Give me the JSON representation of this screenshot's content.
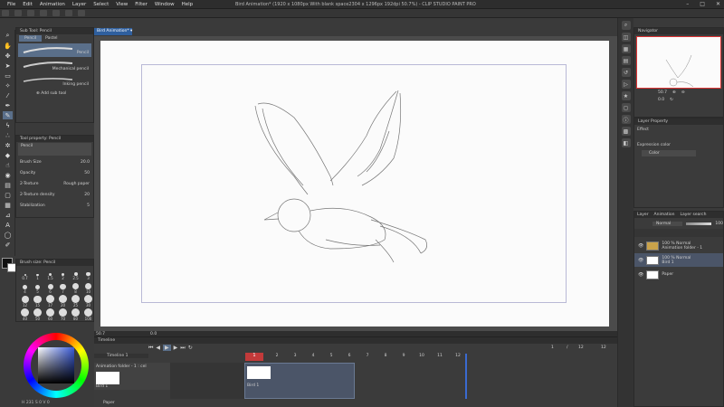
{
  "menu": [
    "File",
    "Edit",
    "Animation",
    "Layer",
    "Select",
    "View",
    "Filter",
    "Window",
    "Help"
  ],
  "window_title": "Bird Animation* (1920 x 1080px With blank space2304 x 1296px 192dpi 50.7%) - CLIP STUDIO PAINT PRO",
  "window_buttons": [
    "–",
    "□",
    "✕"
  ],
  "doc_tab": "Bird Animation* ▾",
  "subtool": {
    "header": "Sub Tool: Pencil",
    "tabs": [
      "Pencil",
      "Pastel"
    ],
    "items": [
      "Pencil",
      "Mechanical pencil",
      "Inking pencil"
    ],
    "add": "Add sub tool"
  },
  "tool_property": {
    "header": "Tool property: Pencil",
    "tool_name": "Pencil",
    "rows": [
      {
        "label": "Brush Size",
        "value": "20.0"
      },
      {
        "label": "Opacity",
        "value": "50"
      },
      {
        "label": "2-Texture",
        "value": "Rough paper"
      },
      {
        "label": "2-Texture density",
        "value": "20"
      },
      {
        "label": "Stabilization",
        "value": "5"
      }
    ]
  },
  "brush_size_panel": {
    "header": "Brush size: Pencil",
    "sizes": [
      "0.7",
      "1",
      "1.5",
      "2",
      "2.5",
      "3",
      "4",
      "5",
      "6",
      "7",
      "8",
      "10",
      "12",
      "15",
      "17",
      "20",
      "25",
      "30",
      "40",
      "50",
      "60",
      "70",
      "80",
      "100"
    ]
  },
  "color_wheel": {
    "value_text": "H 231 S 0 V 0",
    "accent": "#e83a3a"
  },
  "navigator": {
    "header": "Navigator",
    "zoom": "50.7",
    "angle": "0.0"
  },
  "layer_property": {
    "header": "Layer Property",
    "effect": "Effect",
    "expression_color": "Expression color",
    "color_value": "Color"
  },
  "layer_panel": {
    "tabs": [
      "Layer",
      "Animation",
      "Layer search"
    ],
    "blend": "Normal",
    "opacity": "100",
    "layers": [
      {
        "mode": "100 % Normal",
        "name": "Animation folder - 1",
        "type": "folder"
      },
      {
        "mode": "100 % Normal",
        "name": "Bird 1",
        "type": "raster",
        "selected": true
      },
      {
        "mode": "",
        "name": "Paper",
        "type": "paper"
      }
    ]
  },
  "timeline": {
    "header": "Timeline",
    "name": "Timeline 1",
    "frame_rate": "12",
    "current_frame": "1",
    "end_frame": "12",
    "frame_numbers": [
      "1",
      "2",
      "3",
      "4",
      "5",
      "6",
      "7",
      "8",
      "9",
      "10",
      "11",
      "12"
    ],
    "track": "Animation folder - 1 : cel",
    "cel_label": "Bird 1",
    "paper_track": "Paper",
    "marker": "1"
  },
  "status": {
    "zoom": "50.7",
    "x": "0.0"
  },
  "colors": {
    "accent": "#2f5f9e",
    "selection": "#5a6f8a",
    "playhead": "#d04040"
  }
}
